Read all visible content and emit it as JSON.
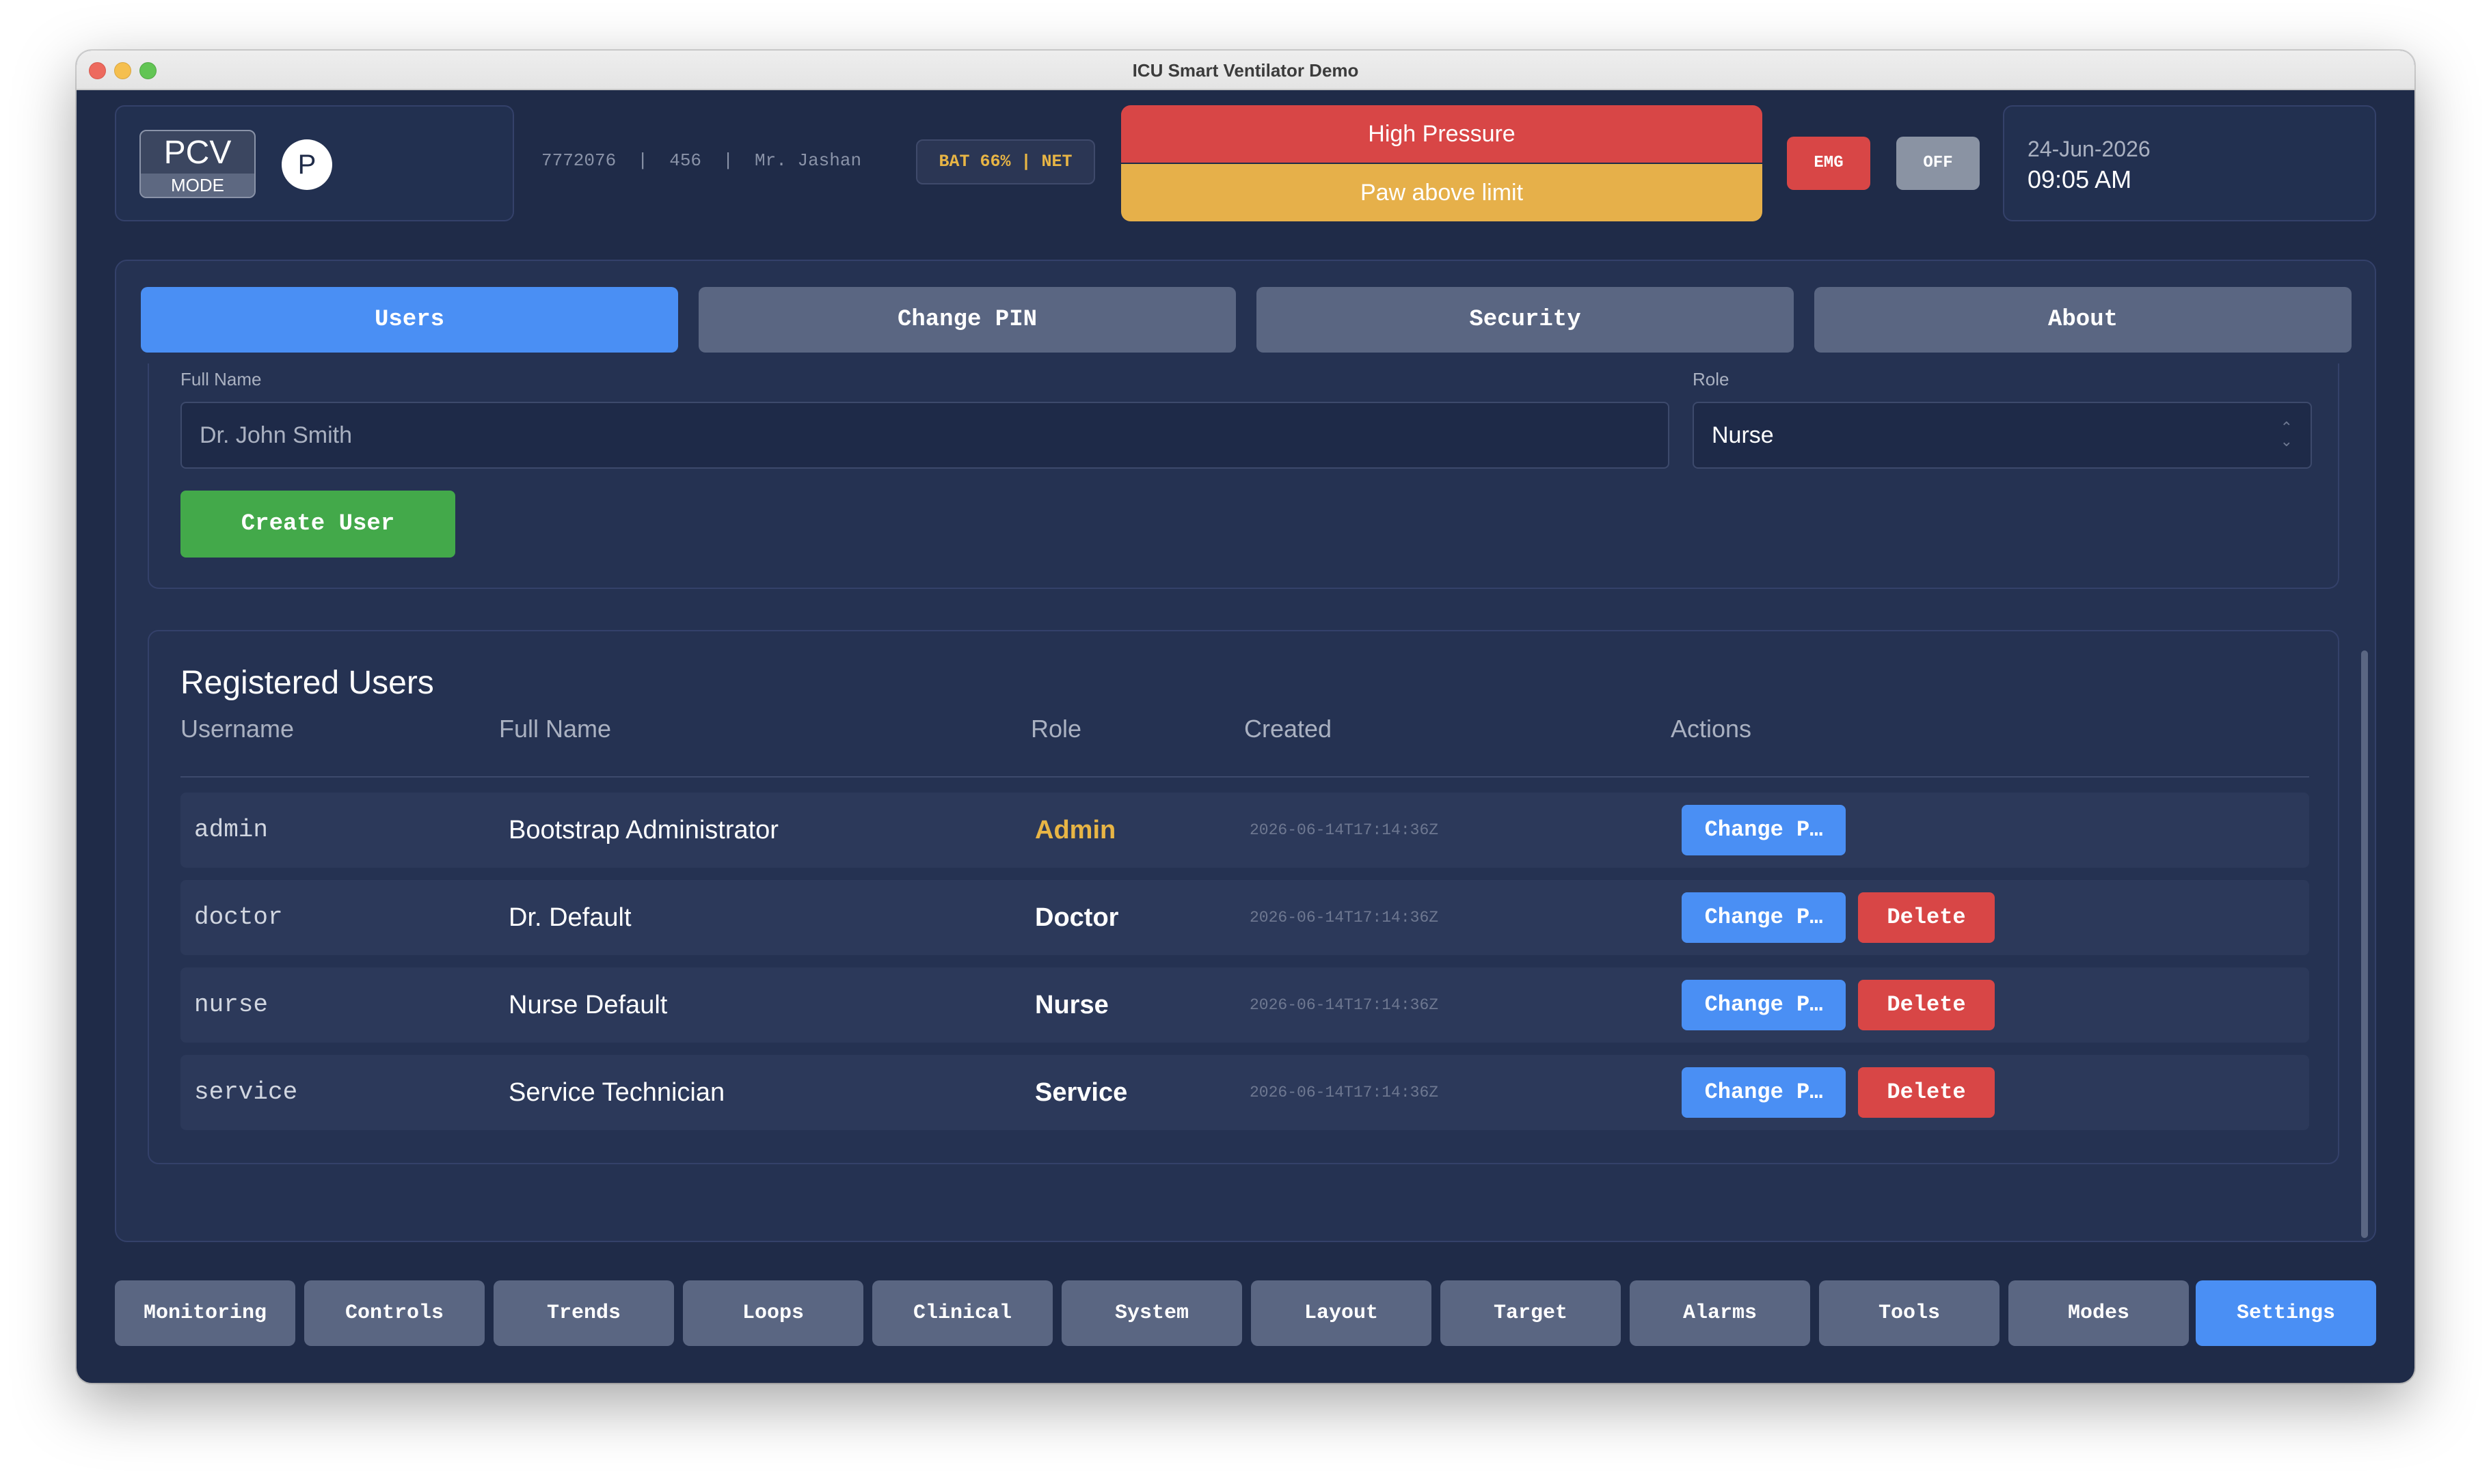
{
  "window": {
    "title": "ICU Smart Ventilator Demo"
  },
  "header": {
    "mode": "PCV",
    "mode_label": "MODE",
    "mode_icon": "P",
    "patient_info": "7772076  |  456  |  Mr. Jashan",
    "status": "BAT 66% | NET",
    "alarm_primary": "High Pressure",
    "alarm_secondary": "Paw above limit",
    "emg_label": "EMG",
    "off_label": "OFF",
    "date": "24-Jun-2026",
    "time": "09:05 AM",
    "colors": {
      "alarm_high": "#d84646",
      "alarm_medium": "#e6b04a",
      "accent": "#4a8ff4"
    }
  },
  "tabs": [
    {
      "label": "Users",
      "active": true
    },
    {
      "label": "Change PIN",
      "active": false
    },
    {
      "label": "Security",
      "active": false
    },
    {
      "label": "About",
      "active": false
    }
  ],
  "form": {
    "full_name_label": "Full Name",
    "full_name_placeholder": "Dr. John Smith",
    "role_label": "Role",
    "role_value": "Nurse",
    "create_button": "Create User"
  },
  "users": {
    "title": "Registered Users",
    "columns": [
      "Username",
      "Full Name",
      "Role",
      "Created",
      "Actions"
    ],
    "rows": [
      {
        "username": "admin",
        "full_name": "Bootstrap Administrator",
        "role": "Admin",
        "created": "2026-06-14T17:14:36Z",
        "change_label": "Change P…",
        "delete_label": ""
      },
      {
        "username": "doctor",
        "full_name": "Dr. Default",
        "role": "Doctor",
        "created": "2026-06-14T17:14:36Z",
        "change_label": "Change P…",
        "delete_label": "Delete"
      },
      {
        "username": "nurse",
        "full_name": "Nurse Default",
        "role": "Nurse",
        "created": "2026-06-14T17:14:36Z",
        "change_label": "Change P…",
        "delete_label": "Delete"
      },
      {
        "username": "service",
        "full_name": "Service Technician",
        "role": "Service",
        "created": "2026-06-14T17:14:36Z",
        "change_label": "Change P…",
        "delete_label": "Delete"
      }
    ]
  },
  "nav": [
    {
      "label": "Monitoring",
      "active": false
    },
    {
      "label": "Controls",
      "active": false
    },
    {
      "label": "Trends",
      "active": false
    },
    {
      "label": "Loops",
      "active": false
    },
    {
      "label": "Clinical",
      "active": false
    },
    {
      "label": "System",
      "active": false
    },
    {
      "label": "Layout",
      "active": false
    },
    {
      "label": "Target",
      "active": false
    },
    {
      "label": "Alarms",
      "active": false
    },
    {
      "label": "Tools",
      "active": false
    },
    {
      "label": "Modes",
      "active": false
    },
    {
      "label": "Settings",
      "active": true
    }
  ]
}
